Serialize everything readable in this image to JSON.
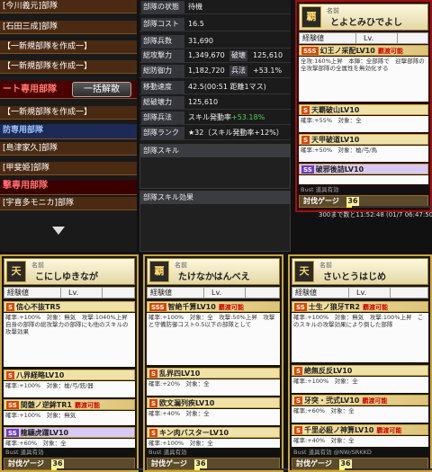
{
  "left_list": {
    "rows": [
      {
        "label": "[今川義元]部隊"
      },
      {
        "label": "[石田三成]部隊"
      },
      {
        "label": "【一新規部隊を作成一】"
      },
      {
        "label": "【一新規部隊を作成一】"
      },
      {
        "label": "ート専用部隊"
      },
      {
        "label": "【一新規部隊を作成一】"
      },
      {
        "label": "防専用部隊"
      },
      {
        "label": "[島津家久]部隊"
      },
      {
        "label": "[甲斐姫]部隊"
      },
      {
        "label": "撃専用部隊"
      },
      {
        "label": "[宇喜多モニカ]部隊"
      }
    ],
    "unlock_button": "一括解散"
  },
  "stats": {
    "rows": [
      {
        "key": "部隊の状態",
        "value": "待機"
      },
      {
        "key": "部隊コスト",
        "value": "16.5"
      },
      {
        "key": "部隊兵数",
        "value": "31,690"
      },
      {
        "key": "総攻撃力",
        "value": "1,349,670",
        "tag": "破壊",
        "tag_value": "125,610"
      },
      {
        "key": "総防御力",
        "value": "1,182,720",
        "tag": "兵法",
        "tag_value": "+53.1%"
      },
      {
        "key": "移動速度",
        "value": "42.5(00:51 距離1マス)"
      },
      {
        "key": "総破壊力",
        "value": "125,610"
      },
      {
        "key": "部隊兵法",
        "value": "スキル発動率",
        "extra": "+53.18%"
      },
      {
        "key": "部隊ランク",
        "value": "★32（スキル発動率+12%）"
      }
    ],
    "panel_skill": "部隊スキル",
    "panel_skill_effect": "部隊スキル効果"
  },
  "cards": [
    {
      "id": "toyotomi",
      "name_small": "名前",
      "name": "とよとみひでよし",
      "exp_label": "経験値",
      "lv_label": "Lv.",
      "skills": [
        {
          "badge": "SSS",
          "name": "幻王ノ采配LV10",
          "note": "覇渡可能",
          "desc": "全攻:160%上昇　本陣：全部隊で　迎撃部隊の全攻撃部隊の全属性を無効化する"
        },
        {
          "badge": "S",
          "name": "天覇破山LV10",
          "desc": "確率:+55%　対象：全"
        },
        {
          "badge": "S",
          "name": "天甲破道LV10",
          "desc": "確率:+50%　対象：槍/弓/馬"
        },
        {
          "badge": "SS",
          "name": "破邪後詰LV10",
          "desc": ""
        }
      ],
      "footer": "Bust 道具有効",
      "gauge_label": "討伐ゲージ",
      "gauge_value": "36",
      "gauge_pct": 0.05
    },
    {
      "id": "kobayashi",
      "name_small": "名前",
      "name": "こにしゆきなが",
      "exp_label": "経験値",
      "lv_label": "Lv.",
      "skills": [
        {
          "badge": "S",
          "name": "信心不抜TR5",
          "desc": "確率:+100%　対象：無気　攻撃:1040%上昇　自身の部隊の総攻撃力の部隊にも他のスキルの攻撃効果"
        },
        {
          "badge": "S",
          "name": "八界経略LV10",
          "desc": "確率:+100%　対象：槍/弓/銃/器"
        },
        {
          "badge": "SS",
          "name": "間髄ノ逆鉾TR1",
          "note": "覇渡可能",
          "desc": "確率:+100%　対象：無気"
        },
        {
          "badge": "SS",
          "name": "龍驤虎躍LV10",
          "desc": "確率:+60%　対象：全"
        }
      ],
      "footer": "Bust 道具有効",
      "gauge_label": "討伐ゲージ",
      "gauge_value": "36",
      "gauge_pct": 0.05
    },
    {
      "id": "takenaka",
      "name_small": "名前",
      "name": "たけなかはんべえ",
      "exp_label": "経験値",
      "lv_label": "Lv.",
      "skills": [
        {
          "badge": "SSS",
          "name": "智絶千算LV10",
          "note": "覇渡可能",
          "desc": "確率:+100%　対象：全　攻撃:50%上昇　攻撃と守備防御コスト0.5以下の部隊として"
        },
        {
          "badge": "S",
          "name": "乱界四LV10",
          "desc": "確率:+20%　対象：全"
        },
        {
          "badge": "S",
          "name": "欧文漏列疾LV10",
          "desc": "確率:+40%　対象：全"
        },
        {
          "badge": "S",
          "name": "キン肉バスターLV10",
          "desc": "確率:+100%　対象：全"
        }
      ],
      "footer": "Bust 道具有効",
      "gauge_label": "討伐ゲージ",
      "gauge_value": "36",
      "gauge_pct": 0.05
    },
    {
      "id": "saito",
      "name_small": "名前",
      "name": "さいとうはじめ",
      "exp_label": "経験値",
      "lv_label": "Lv.",
      "skills": [
        {
          "badge": "SS",
          "name": "士生ノ狼牙TR2",
          "note": "覇渡可能",
          "desc": "確率:+100%　対象：無気　攻撃:100%上昇　このスキルの攻撃効果により倒した部隊"
        },
        {
          "badge": "S",
          "name": "絶無反反LV10",
          "desc": "確率:+100%　対象：全"
        },
        {
          "badge": "S",
          "name": "牙突・弐式LV10",
          "note": "覇渡可能",
          "desc": "確率:+60%　対象：全"
        },
        {
          "badge": "S",
          "name": "千里必殺ノ神算LV10",
          "note": "覇渡可能",
          "desc": "確率:+40%　対象：全"
        }
      ],
      "footer": "Bust 道具有効",
      "gauge_label": "討伐ゲージ",
      "gauge_value": "36",
      "gauge_pct": 0.05
    }
  ],
  "timestamp": "300まで数と11:52:48 (01/7 06:47:50)",
  "credit": "@NW/SRKKD"
}
